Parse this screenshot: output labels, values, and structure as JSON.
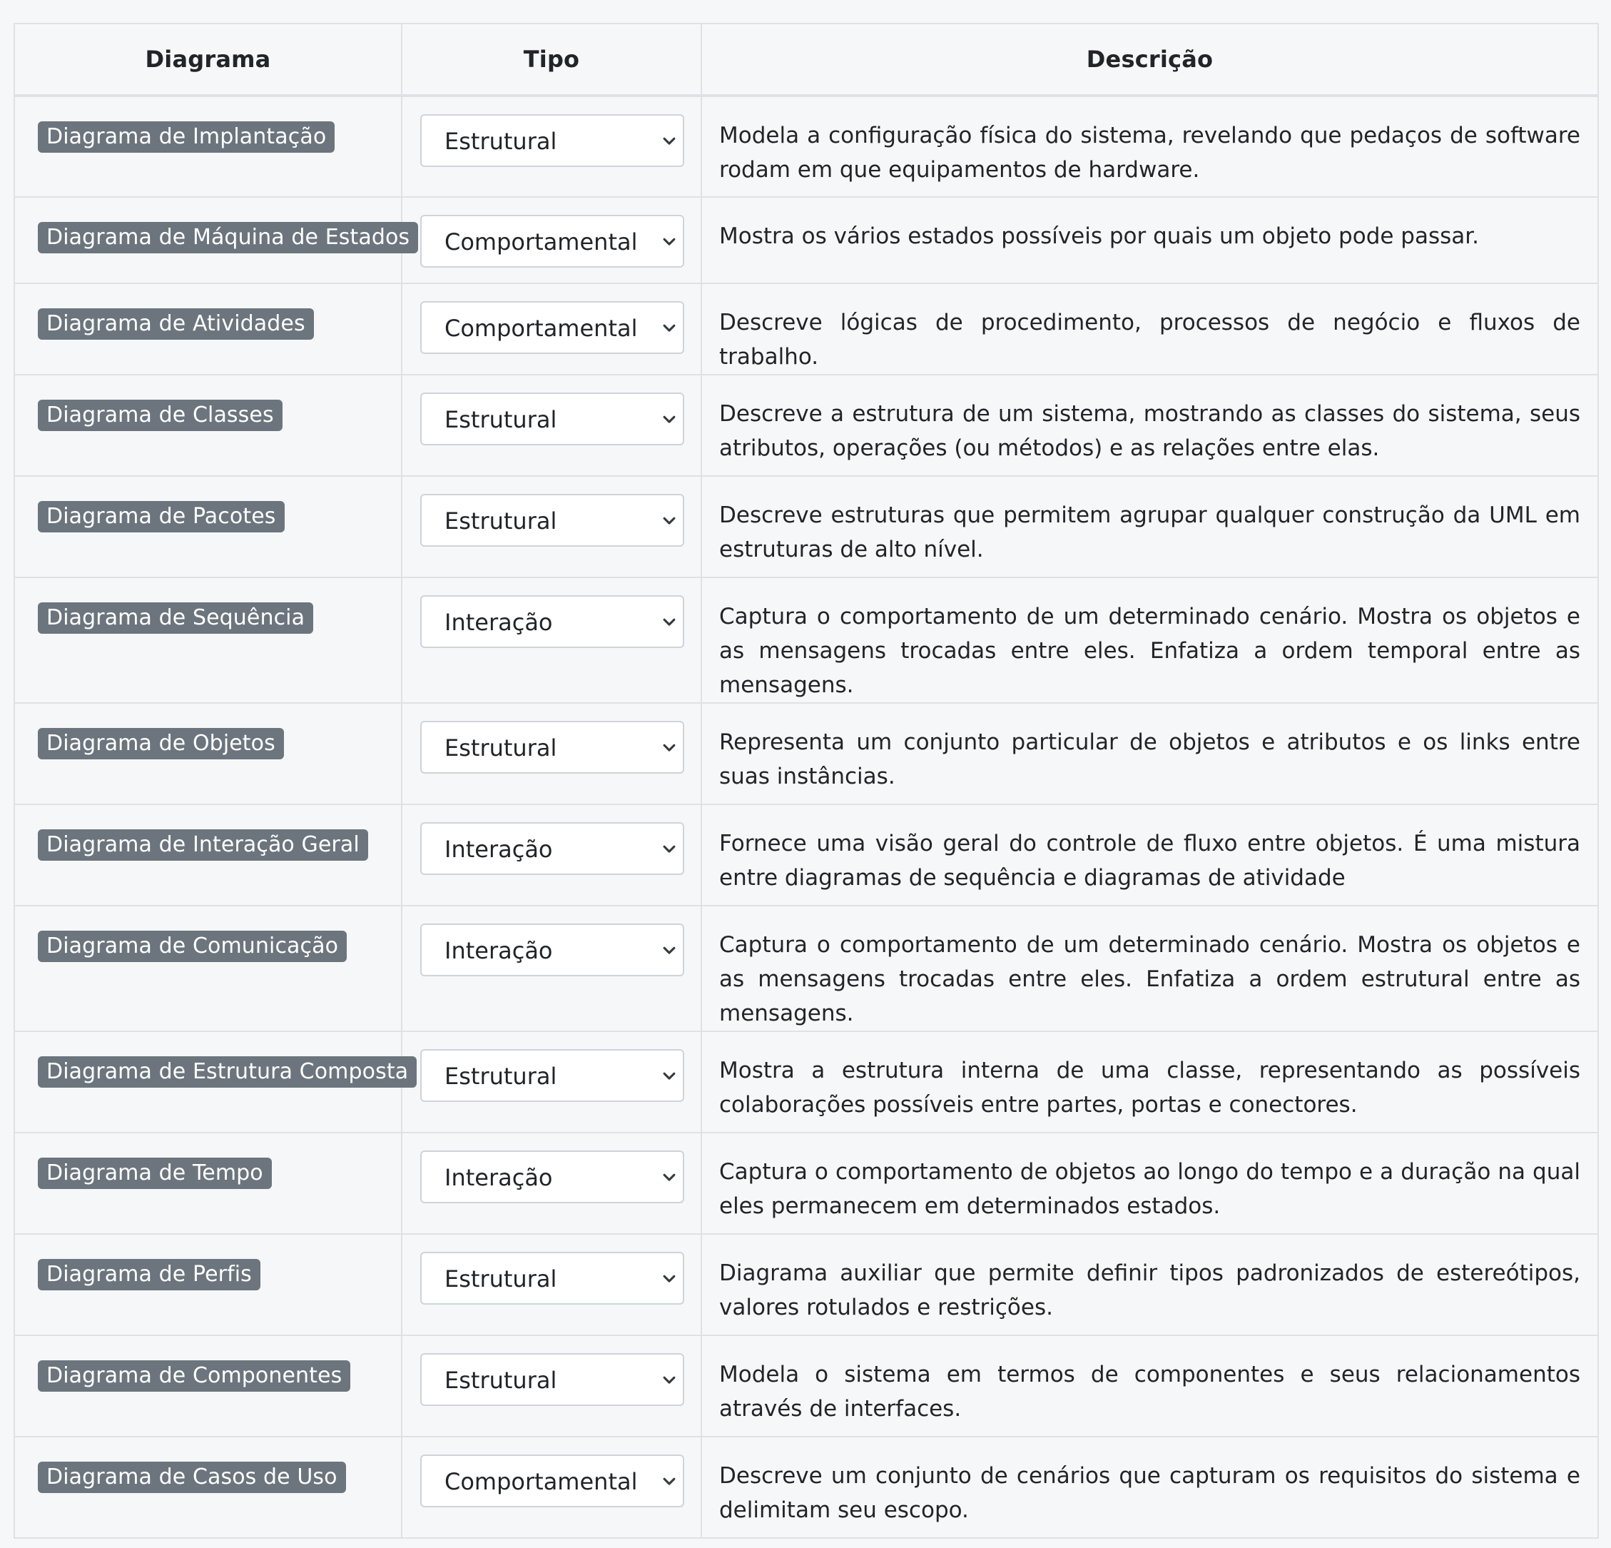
{
  "headers": {
    "diagrama": "Diagrama",
    "tipo": "Tipo",
    "descricao": "Descrição"
  },
  "rows": [
    {
      "diagrama": "Diagrama de Implantação",
      "tipo": "Estrutural",
      "descricao": "Modela a configuração física do sistema, revelando que pedaços de software rodam em que equipamentos de hardware."
    },
    {
      "diagrama": "Diagrama de Máquina de Estados",
      "tipo": "Comportamental",
      "descricao": "Mostra os vários estados possíveis por quais um objeto pode passar."
    },
    {
      "diagrama": "Diagrama de Atividades",
      "tipo": "Comportamental",
      "descricao": "Descreve lógicas de procedimento, processos de negócio e fluxos de trabalho."
    },
    {
      "diagrama": "Diagrama de Classes",
      "tipo": "Estrutural",
      "descricao": "Descreve a estrutura de um sistema, mostrando as classes do sistema, seus atributos, operações (ou métodos) e as relações entre elas."
    },
    {
      "diagrama": "Diagrama de Pacotes",
      "tipo": "Estrutural",
      "descricao": "Descreve estruturas que permitem agrupar qualquer construção da UML em estruturas de alto nível."
    },
    {
      "diagrama": "Diagrama de Sequência",
      "tipo": "Interação",
      "descricao": "Captura o comportamento de um determinado cenário. Mostra os objetos e as mensagens trocadas entre eles. Enfatiza a ordem temporal entre as mensagens."
    },
    {
      "diagrama": "Diagrama de Objetos",
      "tipo": "Estrutural",
      "descricao": "Representa um conjunto particular de objetos e atributos e os links entre suas instâncias."
    },
    {
      "diagrama": "Diagrama de Interação Geral",
      "tipo": "Interação",
      "descricao": "Fornece uma visão geral do controle de fluxo entre objetos. É uma mistura entre diagramas de sequência e diagramas de atividade"
    },
    {
      "diagrama": "Diagrama de Comunicação",
      "tipo": "Interação",
      "descricao": "Captura o comportamento de um determinado cenário. Mostra os objetos e as mensagens trocadas entre eles. Enfatiza a ordem estrutural entre as mensagens."
    },
    {
      "diagrama": "Diagrama de Estrutura Composta",
      "tipo": "Estrutural",
      "descricao": "Mostra a estrutura interna de uma classe, representando as possíveis colaborações possíveis entre partes, portas e conectores."
    },
    {
      "diagrama": "Diagrama de Tempo",
      "tipo": "Interação",
      "descricao": "Captura o comportamento de objetos ao longo do tempo e a duração na qual eles permanecem em determinados estados."
    },
    {
      "diagrama": "Diagrama de Perfis",
      "tipo": "Estrutural",
      "descricao": "Diagrama auxiliar que permite definir tipos padronizados de estereótipos, valores rotulados e restrições."
    },
    {
      "diagrama": "Diagrama de Componentes",
      "tipo": "Estrutural",
      "descricao": "Modela o sistema em termos de componentes e seus relacionamentos através de interfaces."
    },
    {
      "diagrama": "Diagrama de Casos de Uso",
      "tipo": "Comportamental",
      "descricao": "Descreve um conjunto de cenários que capturam os requisitos do sistema e delimitam seu escopo."
    }
  ],
  "row_layout": [
    "double",
    "single",
    "single",
    "double",
    "double",
    "double",
    "double",
    "double",
    "double",
    "double",
    "double",
    "double",
    "double",
    "double"
  ],
  "icons": {
    "select_chevron": "chevron-down-icon"
  },
  "colors": {
    "badge_bg": "#6c757d",
    "badge_text": "#ffffff",
    "border": "#dee2e6",
    "page_bg": "#f6f7f8"
  }
}
